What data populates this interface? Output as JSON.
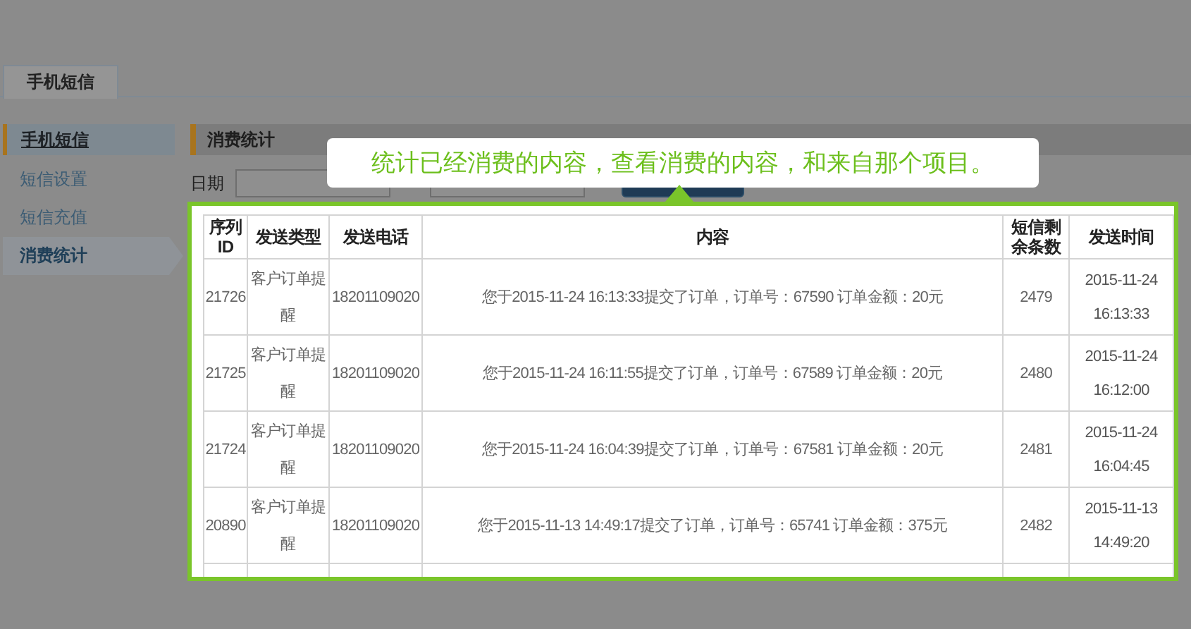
{
  "tabs": [
    {
      "label": "手机短信",
      "selected": true
    }
  ],
  "sidebar": {
    "title": "手机短信",
    "items": [
      {
        "label": "短信设置",
        "selected": false
      },
      {
        "label": "短信充值",
        "selected": false
      },
      {
        "label": "消费统计",
        "selected": true
      }
    ]
  },
  "panel": {
    "title": "消费统计"
  },
  "filter": {
    "label": "日期"
  },
  "callout": {
    "text": "统计已经消费的内容，查看消费的内容，和来自那个项目。"
  },
  "table": {
    "columns": [
      "序列ID",
      "发送类型",
      "发送电话",
      "内容",
      "短信剩余条数",
      "发送时间"
    ],
    "rows": [
      {
        "id": "21726",
        "type": "客户订单提醒",
        "phone": "18201109020",
        "content": "您于2015-11-24 16:13:33提交了订单，订单号：67590 订单金额：20元",
        "remaining": "2479",
        "date": "2015-11-24",
        "time": "16:13:33"
      },
      {
        "id": "21725",
        "type": "客户订单提醒",
        "phone": "18201109020",
        "content": "您于2015-11-24 16:11:55提交了订单，订单号：67589 订单金额：20元",
        "remaining": "2480",
        "date": "2015-11-24",
        "time": "16:12:00"
      },
      {
        "id": "21724",
        "type": "客户订单提醒",
        "phone": "18201109020",
        "content": "您于2015-11-24 16:04:39提交了订单，订单号：67581 订单金额：20元",
        "remaining": "2481",
        "date": "2015-11-24",
        "time": "16:04:45"
      },
      {
        "id": "20890",
        "type": "客户订单提醒",
        "phone": "18201109020",
        "content": "您于2015-11-13 14:49:17提交了订单，订单号：65741 订单金额：375元",
        "remaining": "2482",
        "date": "2015-11-13",
        "time": "14:49:20"
      }
    ]
  }
}
